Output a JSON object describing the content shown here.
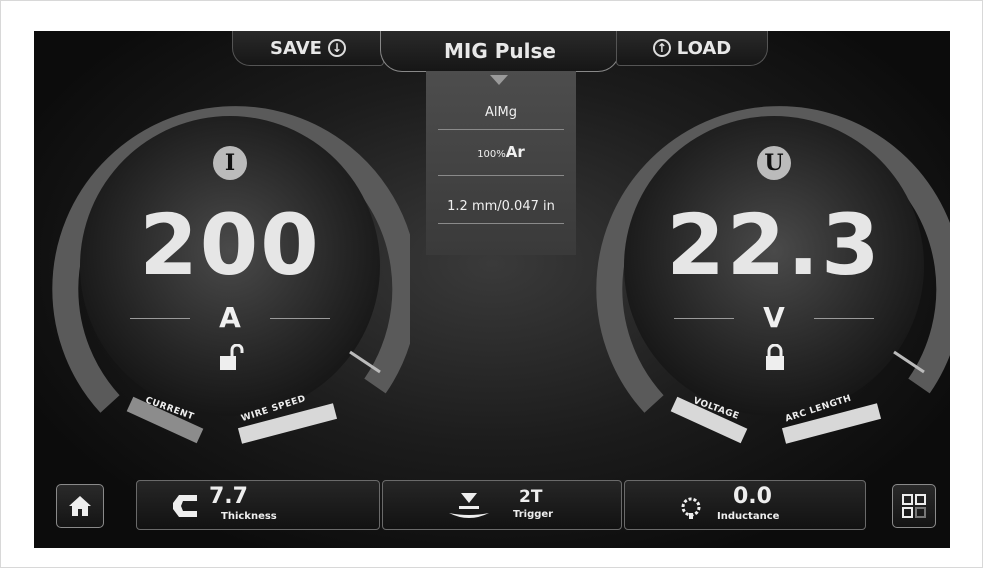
{
  "top_bar": {
    "save_label": "SAVE",
    "mode_label": "MIG Pulse",
    "load_label": "LOAD"
  },
  "process_panel": {
    "material": "AlMg",
    "gas_prefix": "100%",
    "gas": "Ar",
    "wire_diameter": "1.2 mm/0.047 in"
  },
  "current_dial": {
    "badge": "I",
    "value": "200",
    "unit": "A",
    "lock_state": "unlocked",
    "arc_label_left": "CURRENT",
    "arc_label_right": "WIRE SPEED"
  },
  "voltage_dial": {
    "badge": "U",
    "value": "22.3",
    "unit": "V",
    "lock_state": "locked",
    "arc_label_left": "VOLTAGE",
    "arc_label_right": "ARC LENGTH"
  },
  "bottom_bar": {
    "home_icon": "home-icon",
    "thickness_value": "7.7",
    "thickness_label": "Thickness",
    "trigger_value": "2T",
    "trigger_label": "Trigger",
    "inductance_value": "0.0",
    "inductance_label": "Inductance",
    "menu_icon": "grid-icon"
  },
  "colors": {
    "arc_track": "#5a5a5a",
    "arc_active": "#d8d8d8",
    "arc_dim": "#8c8c8c"
  }
}
